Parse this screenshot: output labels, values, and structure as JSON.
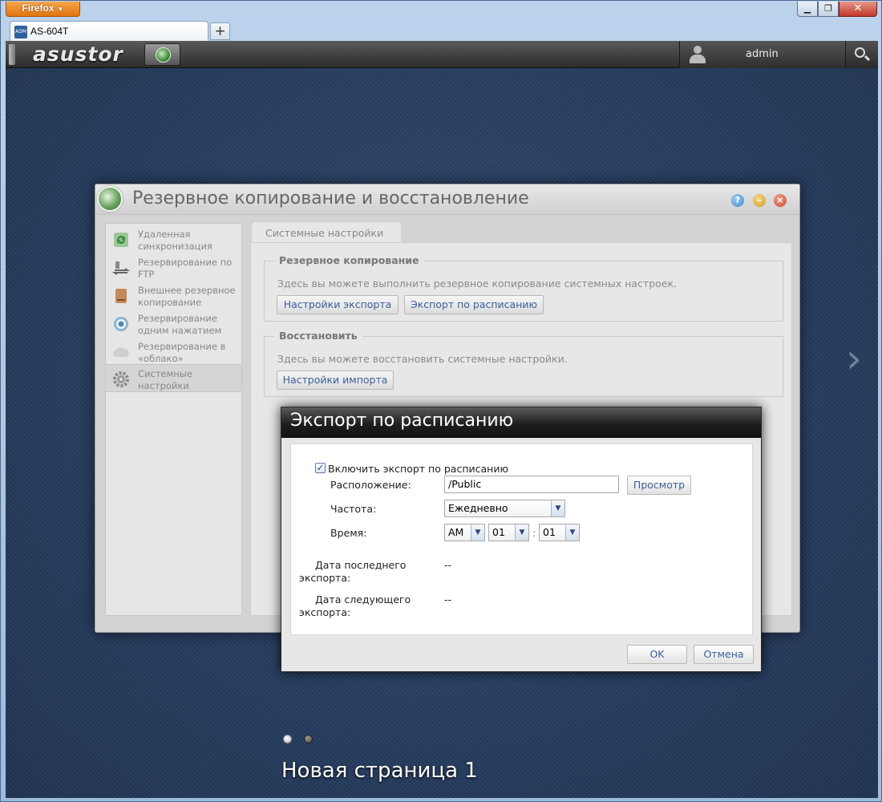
{
  "browser": {
    "menu_label": "Firefox",
    "tab_title": "AS-604T",
    "tab_icon_text": "ADM",
    "new_tab_label": "+",
    "minimize_glyph": "▁",
    "maximize_glyph": "❐",
    "close_glyph": "✕"
  },
  "adm": {
    "logo": "asustor",
    "user": "admin"
  },
  "app": {
    "title": "Резервное копирование и восстановление",
    "sidebar": [
      {
        "label": "Удаленная синхронизация",
        "icon": "sync-icon"
      },
      {
        "label": "Резервирование по FTP",
        "icon": "ftp-icon"
      },
      {
        "label": "Внешнее резервное копирование",
        "icon": "external-drive-icon"
      },
      {
        "label": "Резервирование одним нажатием",
        "icon": "one-touch-icon"
      },
      {
        "label": "Резервирование в «облако»",
        "icon": "cloud-icon"
      },
      {
        "label": "Системные настройки",
        "icon": "gear-icon"
      }
    ],
    "tab": "Системные настройки",
    "backup": {
      "legend": "Резервное копирование",
      "desc": "Здесь вы можете выполнить резервное копирование системных настроек.",
      "export_btn": "Настройки экспорта",
      "schedule_btn": "Экспорт по расписанию"
    },
    "restore": {
      "legend": "Восстановить",
      "desc": "Здесь вы можете восстановить системные настройки.",
      "import_btn": "Настройки импорта"
    }
  },
  "dialog": {
    "title": "Экспорт по расписанию",
    "enable_label": "Включить экспорт по расписанию",
    "enable_checked": true,
    "check_glyph": "✓",
    "location_label": "Расположение:",
    "location_value": "/Public",
    "browse_btn": "Просмотр",
    "frequency_label": "Частота:",
    "frequency_value": "Ежедневно",
    "time_label": "Время:",
    "time_ampm": "AM",
    "time_hour": "01",
    "time_sep": ":",
    "time_minute": "01",
    "last_export_label": "Дата последнего экспорта:",
    "last_export_value": "--",
    "next_export_label": "Дата следующего экспорта:",
    "next_export_value": "--",
    "ok_btn": "OK",
    "cancel_btn": "Отмена"
  },
  "desktop": {
    "page_label": "Новая страница 1",
    "next_glyph": "›"
  }
}
